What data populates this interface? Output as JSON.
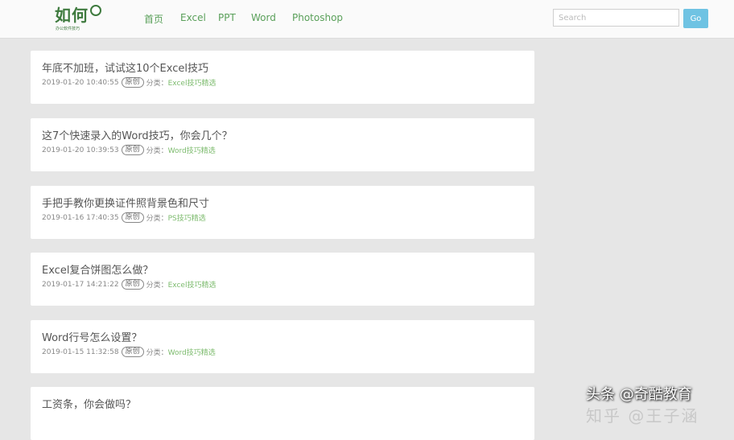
{
  "header": {
    "logo": {
      "main": "如何",
      "sub": "办公软件技巧"
    },
    "nav": [
      {
        "label": "首页"
      },
      {
        "label": "Excel"
      },
      {
        "label": "PPT"
      },
      {
        "label": "Word"
      },
      {
        "label": "Photoshop"
      }
    ],
    "search": {
      "placeholder": "Search",
      "button_label": "Go"
    }
  },
  "posts": [
    {
      "title": "年底不加班，试试这10个Excel技巧",
      "datetime": "2019-01-20 10:40:55",
      "badge": "原创",
      "category_label": "分类：",
      "category": "Excel技巧精选"
    },
    {
      "title": "这7个快速录入的Word技巧，你会几个？",
      "datetime": "2019-01-20 10:39:53",
      "badge": "原创",
      "category_label": "分类：",
      "category": "Word技巧精选"
    },
    {
      "title": "手把手教你更换证件照背景色和尺寸",
      "datetime": "2019-01-16 17:40:35",
      "badge": "原创",
      "category_label": "分类：",
      "category": "PS技巧精选"
    },
    {
      "title": "Excel复合饼图怎么做？",
      "datetime": "2019-01-17 14:21:22",
      "badge": "原创",
      "category_label": "分类：",
      "category": "Excel技巧精选"
    },
    {
      "title": "Word行号怎么设置？",
      "datetime": "2019-01-15 11:32:58",
      "badge": "原创",
      "category_label": "分类：",
      "category": "Word技巧精选"
    },
    {
      "title": "工资条，你会做吗？",
      "datetime": "",
      "badge": "",
      "category_label": "",
      "category": ""
    }
  ],
  "watermark": {
    "text": "头条 @奇酷教育",
    "bottom_text": "知乎 @王子涵"
  }
}
